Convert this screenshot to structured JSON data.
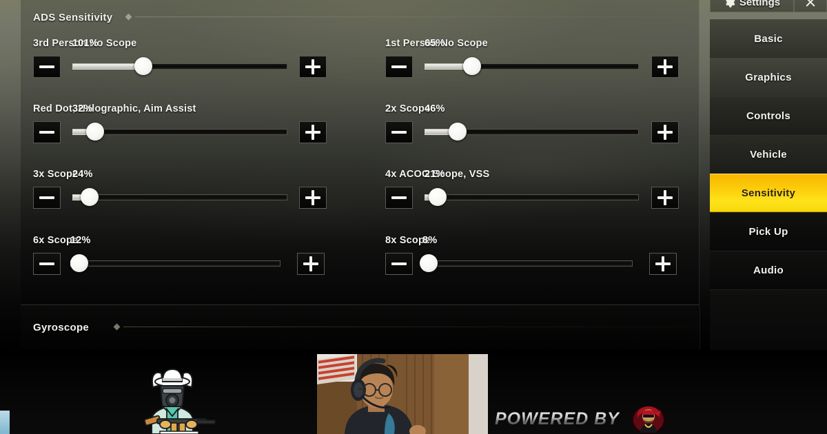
{
  "app": {
    "title": "Settings",
    "close_label": "✕",
    "gear_icon": "gear-icon"
  },
  "sidebar": {
    "items": [
      {
        "label": "Basic",
        "active": false
      },
      {
        "label": "Graphics",
        "active": false
      },
      {
        "label": "Controls",
        "active": false
      },
      {
        "label": "Vehicle",
        "active": false
      },
      {
        "label": "Sensitivity",
        "active": true
      },
      {
        "label": "Pick Up",
        "active": false
      },
      {
        "label": "Audio",
        "active": false
      }
    ],
    "active_color": "#ffd90f",
    "active_text_color": "#2a2205"
  },
  "sections": [
    {
      "id": "ads",
      "title": "ADS Sensitivity"
    },
    {
      "id": "gyro",
      "title": "Gyroscope"
    }
  ],
  "controls": {
    "minus_label": "—",
    "plus_label": "＋"
  },
  "sliders": [
    {
      "label": "3rd Person No Scope",
      "value": "101%",
      "percent": 33,
      "column": "left",
      "row": 0
    },
    {
      "label": "1st Person No Scope",
      "value": "65%",
      "percent": 22,
      "column": "right",
      "row": 0
    },
    {
      "label": "Red Dot, Holographic, Aim Assist",
      "value": "32%",
      "percent": 10,
      "column": "left",
      "row": 1
    },
    {
      "label": "2x Scope",
      "value": "46%",
      "percent": 15,
      "column": "right",
      "row": 1
    },
    {
      "label": "3x Scope",
      "value": "24%",
      "percent": 8,
      "column": "left",
      "row": 2
    },
    {
      "label": "4x ACOG Scope, VSS",
      "value": "21%",
      "percent": 6,
      "column": "right",
      "row": 2
    },
    {
      "label": "6x Scope",
      "value": "12%",
      "percent": 3,
      "column": "left",
      "row": 3
    },
    {
      "label": "8x Scope",
      "value": "8%",
      "percent": 2,
      "column": "right",
      "row": 3
    }
  ],
  "stream_overlay": {
    "powered_by_text": "POWERED BY",
    "mascot_name": "gaming-mascot-logo",
    "sponsor_name": "sponsor-logo",
    "webcam_name": "streamer-webcam"
  }
}
